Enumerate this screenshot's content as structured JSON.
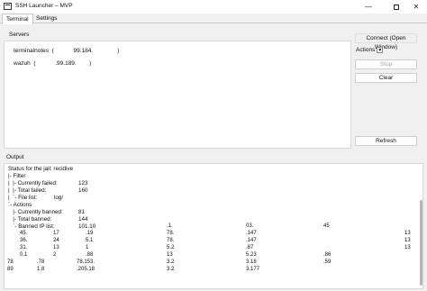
{
  "window": {
    "title": "SSH Launcher – MVP",
    "minimize_glyph": "—",
    "close_glyph": "✕"
  },
  "tabs": [
    {
      "label": "Terminal",
      "active": true
    },
    {
      "label": "Settings",
      "active": false
    }
  ],
  "servers": {
    "label": "Servers",
    "items": [
      {
        "text": "terminalnotes  (            99.184.               )"
      },
      {
        "text": "wazuh  (            .99.189.        )"
      }
    ]
  },
  "sidebar": {
    "connect_label": "Connect (Open Window)",
    "actions_label": "Actions",
    "actions_caret": "▼",
    "stop_label": "Stop",
    "clear_label": "Clear",
    "refresh_label": "Refresh"
  },
  "output": {
    "label": "Output",
    "lines": [
      {
        "text": "Status for the jail: recidive",
        "value": ""
      },
      {
        "text": "|- Filter",
        "value": ""
      },
      {
        "text": "|  |- Currently failed:",
        "value": "123"
      },
      {
        "text": "|  |- Total failed:",
        "value": "160"
      },
      {
        "text": "|  `- File list:",
        "value": "log/"
      },
      {
        "text": "`- Actions",
        "value": ""
      },
      {
        "text": "   |- Currently banned:",
        "value": "81"
      },
      {
        "text": "   |- Total banned:",
        "value": "144"
      },
      {
        "text": "   `- Banned IP list:",
        "value": "101.10"
      }
    ],
    "ip_rows": [
      [
        "45.",
        "17",
        ".19",
        "78.",
        ".147",
        "13"
      ],
      [
        "36.",
        "24",
        "5.1",
        "78.",
        ".147",
        "13"
      ],
      [
        "31.",
        "13",
        "1",
        "5.2",
        ".87",
        "13"
      ],
      [
        "0.1",
        "2",
        ".88",
        "13",
        "5.23",
        ".86"
      ],
      [
        "78",
        ".78",
        "78.153.",
        "3.2",
        "3.18",
        ".59"
      ],
      [
        "89",
        "1.8",
        ".205.18",
        "3.2",
        "3.177",
        ""
      ]
    ],
    "ip_list_tail": [
      ".1.",
      "03.",
      "45"
    ]
  }
}
